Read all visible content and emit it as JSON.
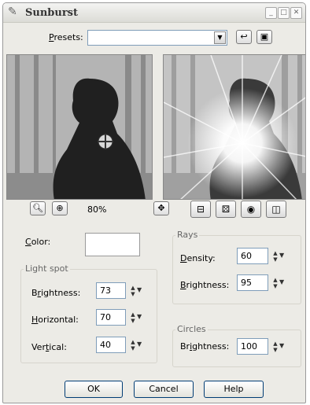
{
  "window": {
    "title": "Sunburst",
    "title_icon": "paint-palette-icon",
    "controls": [
      "_",
      "□",
      "✕"
    ]
  },
  "presets": {
    "label": "Presets:",
    "value": ""
  },
  "preview": {
    "zoom_label": "80%",
    "zoom_out_icon": "zoom-out-icon",
    "zoom_in_icon": "zoom-in-icon",
    "pan_icon": "move-icon"
  },
  "color": {
    "label": "Color:",
    "value": "#ffffff"
  },
  "light_spot": {
    "title": "Light spot",
    "brightness": {
      "label": "Brightness:",
      "value": "73"
    },
    "horizontal": {
      "label": "Horizontal:",
      "value": "70"
    },
    "vertical": {
      "label": "Vertical:",
      "value": "40"
    }
  },
  "rays": {
    "title": "Rays",
    "density": {
      "label": "Density:",
      "value": "60"
    },
    "brightness": {
      "label": "Brightness:",
      "value": "95"
    }
  },
  "circles": {
    "title": "Circles",
    "brightness": {
      "label": "Brightness:",
      "value": "100"
    }
  },
  "buttons": {
    "ok": "OK",
    "cancel": "Cancel",
    "help": "Help"
  }
}
